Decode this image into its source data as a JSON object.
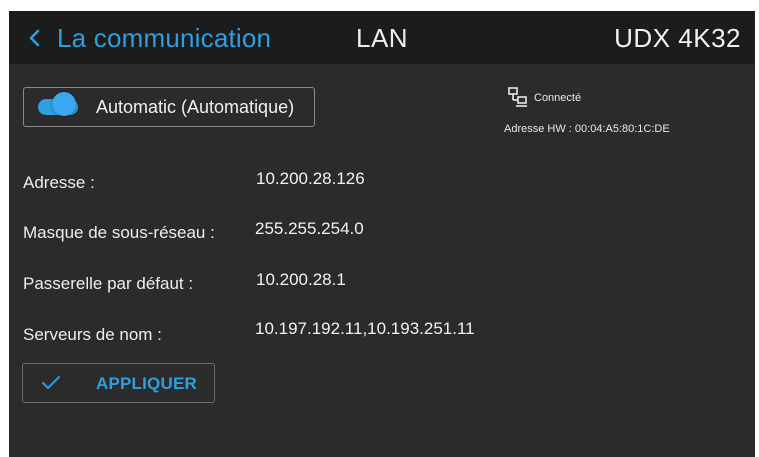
{
  "header": {
    "back_label": "La communication",
    "title": "LAN",
    "device_name": "UDX 4K32"
  },
  "dhcp_toggle": {
    "label": "Automatic (Automatique)",
    "enabled": true
  },
  "connection": {
    "status": "Connecté",
    "hw_address": "Adresse HW : 00:04:A5:80:1C:DE"
  },
  "fields": [
    {
      "label": "Adresse :",
      "value": "10.200.28.126"
    },
    {
      "label": "Masque de sous-réseau :",
      "value": "255.255.254.0"
    },
    {
      "label": "Passerelle par défaut :",
      "value": "10.200.28.1"
    },
    {
      "label": "Serveurs de nom :",
      "value": "10.197.192.11,10.193.251.11"
    }
  ],
  "apply_button": {
    "label": "APPLIQUER"
  },
  "colors": {
    "accent": "#2f9fe0",
    "background": "#2b2b2c",
    "header_background": "#1c1c1d",
    "text": "#f0f0f0"
  },
  "icons": {
    "back": "chevron-left-icon",
    "network": "network-icon",
    "apply": "checkmark-icon"
  }
}
